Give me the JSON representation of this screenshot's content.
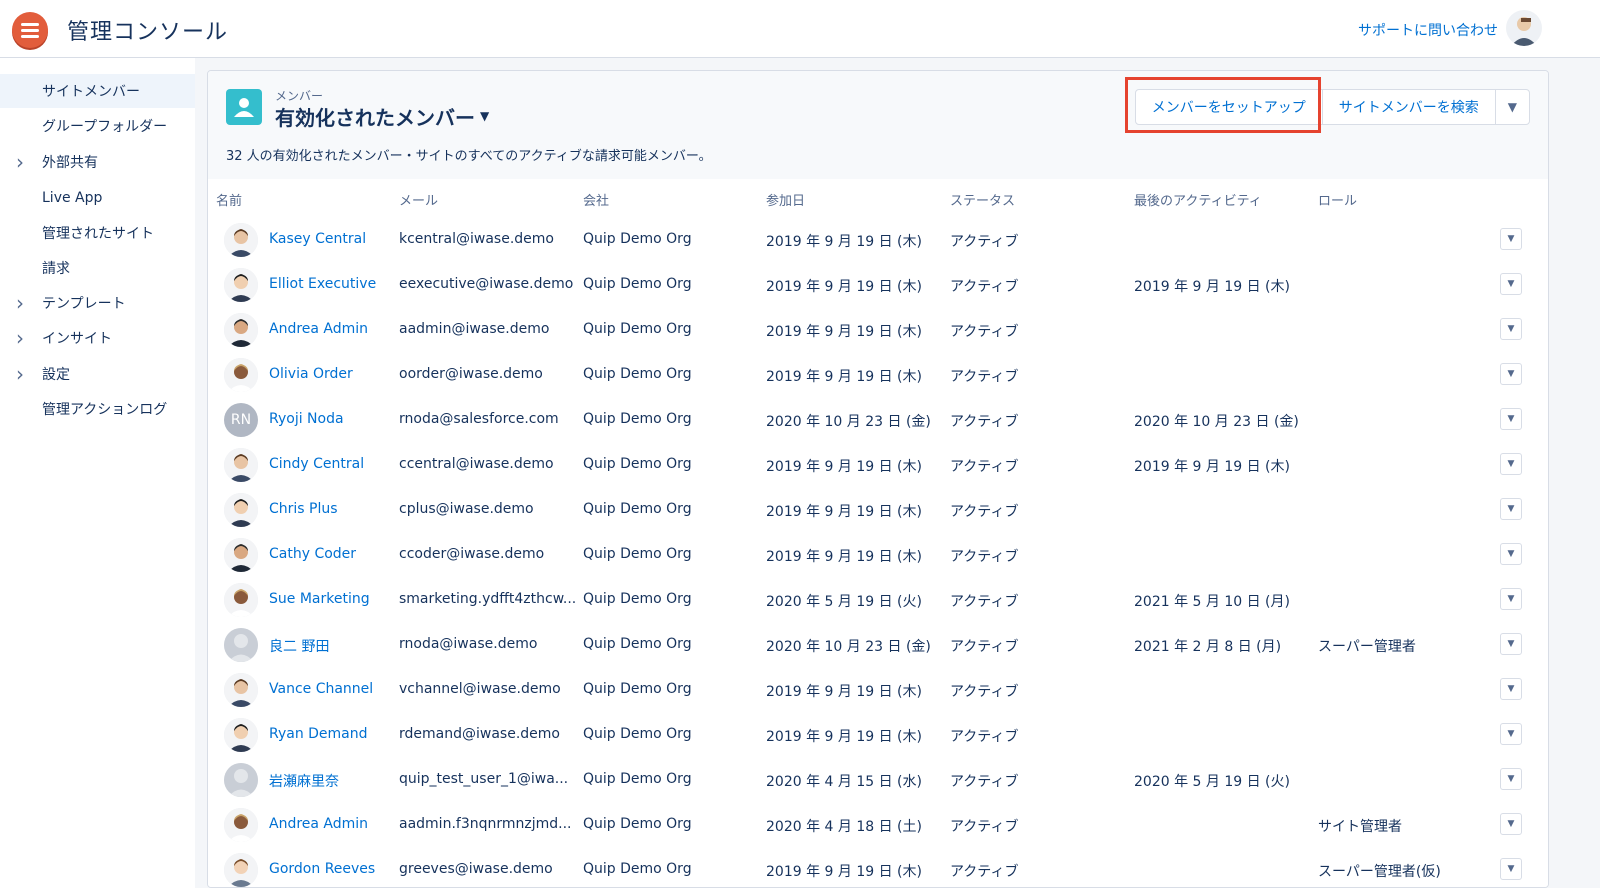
{
  "header": {
    "app_title": "管理コンソール",
    "support_link": "サポートに問い合わせ"
  },
  "sidebar": {
    "items": [
      {
        "label": "サイトメンバー",
        "active": true,
        "expandable": false
      },
      {
        "label": "グループフォルダー",
        "active": false,
        "expandable": false
      },
      {
        "label": "外部共有",
        "active": false,
        "expandable": true
      },
      {
        "label": "Live App",
        "active": false,
        "expandable": false
      },
      {
        "label": "管理されたサイト",
        "active": false,
        "expandable": false
      },
      {
        "label": "請求",
        "active": false,
        "expandable": false
      },
      {
        "label": "テンプレート",
        "active": false,
        "expandable": true
      },
      {
        "label": "インサイト",
        "active": false,
        "expandable": true
      },
      {
        "label": "設定",
        "active": false,
        "expandable": true
      },
      {
        "label": "管理アクションログ",
        "active": false,
        "expandable": false
      }
    ]
  },
  "view": {
    "eyebrow": "メンバー",
    "title": "有効化されたメンバー",
    "summary": "32 人の有効化されたメンバー・サイトのすべてのアクティブな請求可能メンバー。",
    "setup_button": "メンバーをセットアップ",
    "search_button": "サイトメンバーを検索"
  },
  "table": {
    "columns": [
      "名前",
      "メール",
      "会社",
      "参加日",
      "ステータス",
      "最後のアクティビティ",
      "ロール"
    ],
    "rows": [
      {
        "avatar": "photo",
        "name": "Kasey Central",
        "email": "kcentral@iwase.demo",
        "company": "Quip Demo Org",
        "joined": "2019 年 9 月 19 日 (木)",
        "status": "アクティブ",
        "last": "",
        "role": ""
      },
      {
        "avatar": "photo",
        "name": "Elliot Executive",
        "email": "eexecutive@iwase.demo",
        "company": "Quip Demo Org",
        "joined": "2019 年 9 月 19 日 (木)",
        "status": "アクティブ",
        "last": "2019 年 9 月 19 日 (木)",
        "role": ""
      },
      {
        "avatar": "photo",
        "name": "Andrea Admin",
        "email": "aadmin@iwase.demo",
        "company": "Quip Demo Org",
        "joined": "2019 年 9 月 19 日 (木)",
        "status": "アクティブ",
        "last": "",
        "role": ""
      },
      {
        "avatar": "photo",
        "name": "Olivia Order",
        "email": "oorder@iwase.demo",
        "company": "Quip Demo Org",
        "joined": "2019 年 9 月 19 日 (木)",
        "status": "アクティブ",
        "last": "",
        "role": ""
      },
      {
        "avatar": "RN",
        "name": "Ryoji Noda",
        "email": "rnoda@salesforce.com",
        "company": "Quip Demo Org",
        "joined": "2020 年 10 月 23 日 (金)",
        "status": "アクティブ",
        "last": "2020 年 10 月 23 日 (金)",
        "role": ""
      },
      {
        "avatar": "photo",
        "name": "Cindy Central",
        "email": "ccentral@iwase.demo",
        "company": "Quip Demo Org",
        "joined": "2019 年 9 月 19 日 (木)",
        "status": "アクティブ",
        "last": "2019 年 9 月 19 日 (木)",
        "role": ""
      },
      {
        "avatar": "photo",
        "name": "Chris Plus",
        "email": "cplus@iwase.demo",
        "company": "Quip Demo Org",
        "joined": "2019 年 9 月 19 日 (木)",
        "status": "アクティブ",
        "last": "",
        "role": ""
      },
      {
        "avatar": "photo",
        "name": "Cathy Coder",
        "email": "ccoder@iwase.demo",
        "company": "Quip Demo Org",
        "joined": "2019 年 9 月 19 日 (木)",
        "status": "アクティブ",
        "last": "",
        "role": ""
      },
      {
        "avatar": "photo",
        "name": "Sue Marketing",
        "email": "smarketing.ydfft4zthcw...",
        "company": "Quip Demo Org",
        "joined": "2020 年 5 月 19 日 (火)",
        "status": "アクティブ",
        "last": "2021 年 5 月 10 日 (月)",
        "role": ""
      },
      {
        "avatar": "placeholder",
        "name": "良二 野田",
        "email": "rnoda@iwase.demo",
        "company": "Quip Demo Org",
        "joined": "2020 年 10 月 23 日 (金)",
        "status": "アクティブ",
        "last": "2021 年 2 月 8 日 (月)",
        "role": "スーパー管理者"
      },
      {
        "avatar": "photo",
        "name": "Vance Channel",
        "email": "vchannel@iwase.demo",
        "company": "Quip Demo Org",
        "joined": "2019 年 9 月 19 日 (木)",
        "status": "アクティブ",
        "last": "",
        "role": ""
      },
      {
        "avatar": "photo",
        "name": "Ryan Demand",
        "email": "rdemand@iwase.demo",
        "company": "Quip Demo Org",
        "joined": "2019 年 9 月 19 日 (木)",
        "status": "アクティブ",
        "last": "",
        "role": ""
      },
      {
        "avatar": "placeholder",
        "name": "岩瀬麻里奈",
        "email": "quip_test_user_1@iwa...",
        "company": "Quip Demo Org",
        "joined": "2020 年 4 月 15 日 (水)",
        "status": "アクティブ",
        "last": "2020 年 5 月 19 日 (火)",
        "role": ""
      },
      {
        "avatar": "photo",
        "name": "Andrea Admin",
        "email": "aadmin.f3nqnrmnzjmd...",
        "company": "Quip Demo Org",
        "joined": "2020 年 4 月 18 日 (土)",
        "status": "アクティブ",
        "last": "",
        "role": "サイト管理者"
      },
      {
        "avatar": "photo",
        "name": "Gordon Reeves",
        "email": "greeves@iwase.demo",
        "company": "Quip Demo Org",
        "joined": "2019 年 9 月 19 日 (木)",
        "status": "アクティブ",
        "last": "",
        "role": "スーパー管理者(仮)"
      }
    ]
  },
  "colors": {
    "accent": "#0070d2",
    "brand": "#e25d3c",
    "highlight": "#e5432f",
    "object_icon": "#34becd"
  }
}
